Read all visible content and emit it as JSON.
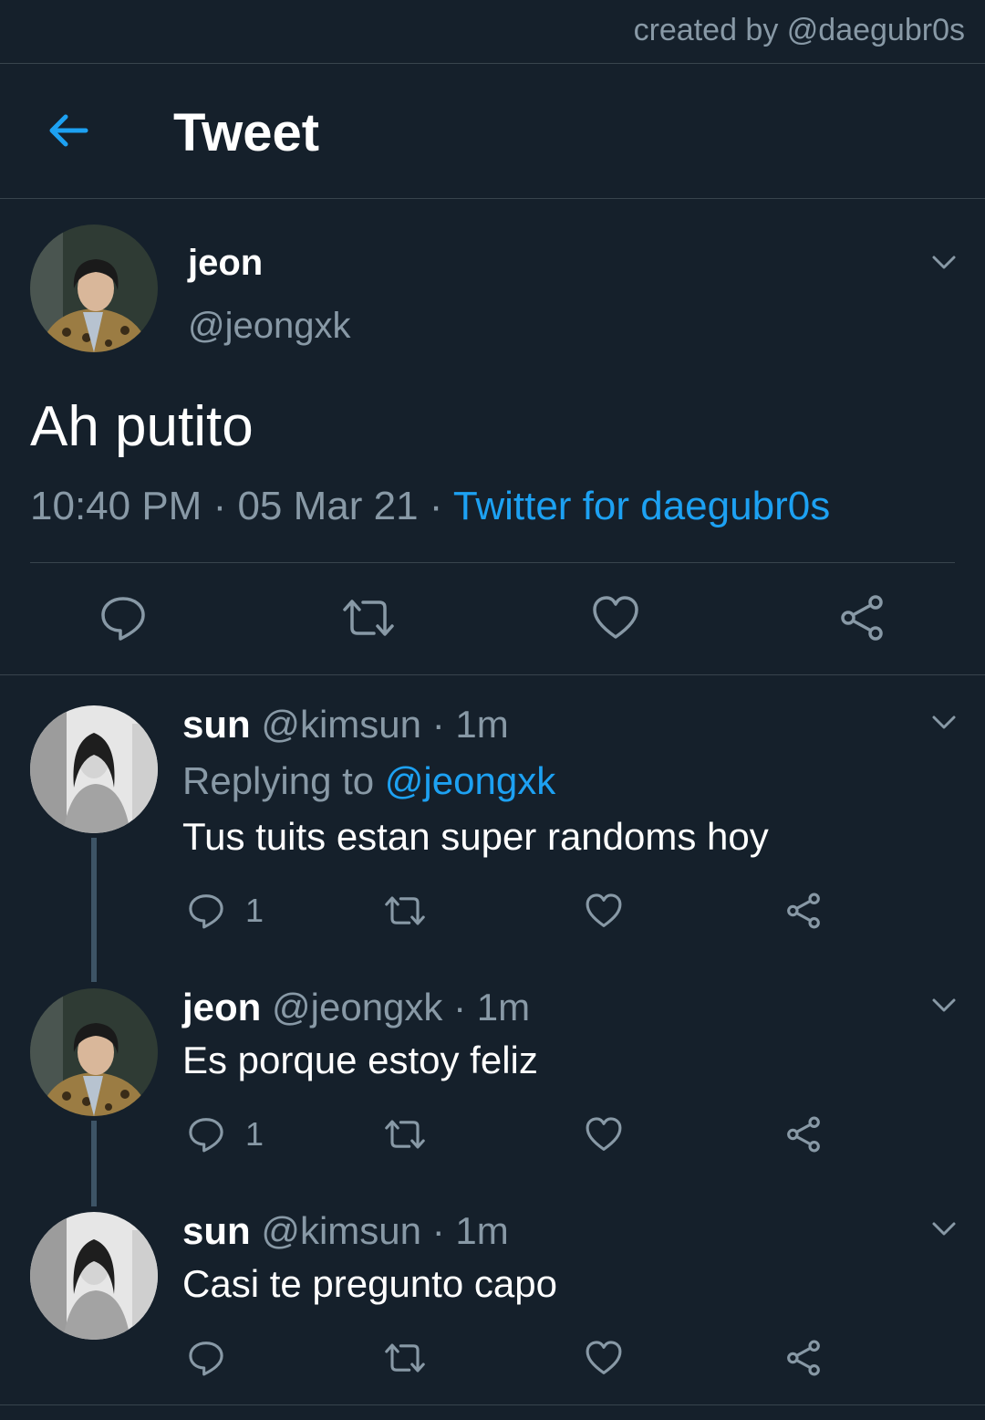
{
  "credit": "created by @daegubr0s",
  "header": {
    "title": "Tweet"
  },
  "main_tweet": {
    "name": "jeon",
    "handle": "@jeongxk",
    "text": "Ah putito",
    "time": "10:40 PM",
    "date": "05 Mar 21",
    "source": "Twitter for daegubr0s",
    "separator": " · "
  },
  "replies": [
    {
      "name": "sun",
      "handle": "@kimsun",
      "age": "1m",
      "replying_prefix": "Replying to ",
      "replying_to": "@jeongxk",
      "text": "Tus tuits estan super randoms hoy",
      "reply_count": "1"
    },
    {
      "name": "jeon",
      "handle": "@jeongxk",
      "age": "1m",
      "text": "Es porque estoy feliz",
      "reply_count": "1"
    },
    {
      "name": "sun",
      "handle": "@kimsun",
      "age": "1m",
      "text": "Casi te pregunto capo",
      "reply_count": ""
    }
  ],
  "colors": {
    "background": "#15202b",
    "accent": "#1da1f2",
    "muted": "#8899a6",
    "divider": "#38444d"
  },
  "icons": [
    "back-arrow-icon",
    "chevron-down-icon",
    "reply-icon",
    "retweet-icon",
    "like-icon",
    "share-icon"
  ]
}
